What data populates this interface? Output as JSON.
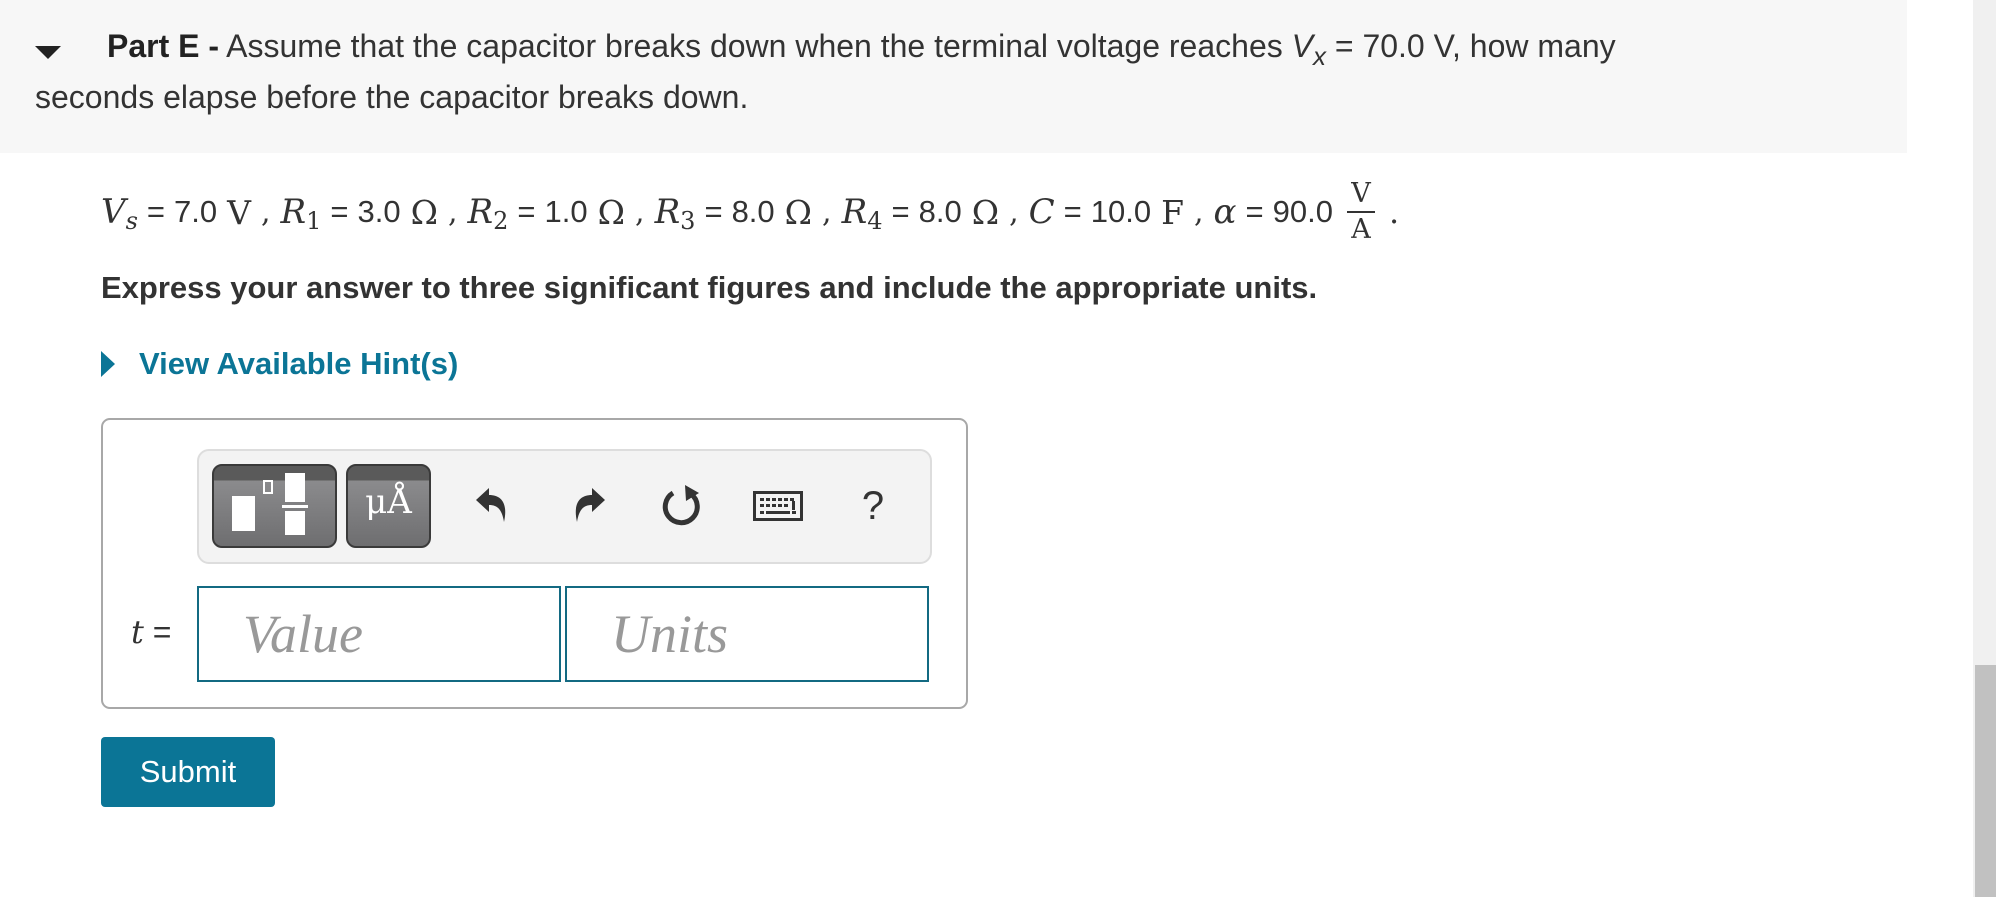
{
  "question": {
    "part_label": "Part E -",
    "text_before_var": " Assume that the capacitor breaks down when the terminal voltage reaches ",
    "var_name": "V",
    "var_subscript": "x",
    "text_after_var": " = 70.0 V, how many",
    "line2": "seconds elapse before the capacitor breaks down."
  },
  "given": {
    "items": [
      {
        "symbol": "V",
        "subscript": "s",
        "value": "7.0",
        "unit": "V"
      },
      {
        "symbol": "R",
        "subscript": "1",
        "value": "3.0",
        "unit": "Ω"
      },
      {
        "symbol": "R",
        "subscript": "2",
        "value": "1.0",
        "unit": "Ω"
      },
      {
        "symbol": "R",
        "subscript": "3",
        "value": "8.0",
        "unit": "Ω"
      },
      {
        "symbol": "R",
        "subscript": "4",
        "value": "8.0",
        "unit": "Ω"
      },
      {
        "symbol": "C",
        "subscript": "",
        "value": "10.0",
        "unit": "F"
      },
      {
        "symbol": "α",
        "subscript": "",
        "value": "90.0",
        "unit_num": "V",
        "unit_den": "A"
      }
    ],
    "equals": "=",
    "separator": ",",
    "terminator": "."
  },
  "instructions": "Express your answer to three significant figures and include the appropriate units.",
  "hint": {
    "label": "View Available Hint(s)",
    "accent": "#0b7596"
  },
  "toolbar": {
    "template_button": "templates",
    "units_button_glyph": "μÅ",
    "undo": "undo-icon",
    "redo": "redo-icon",
    "reset": "reset-icon",
    "keyboard": "keyboard-icon",
    "help_glyph": "?"
  },
  "answer": {
    "variable": "t",
    "equals": "=",
    "value_placeholder": "Value",
    "value": "",
    "units_placeholder": "Units",
    "units": ""
  },
  "submit_label": "Submit",
  "colors": {
    "primary": "#0b7596",
    "input_border": "#136a82",
    "header_bg": "#f7f7f7"
  }
}
